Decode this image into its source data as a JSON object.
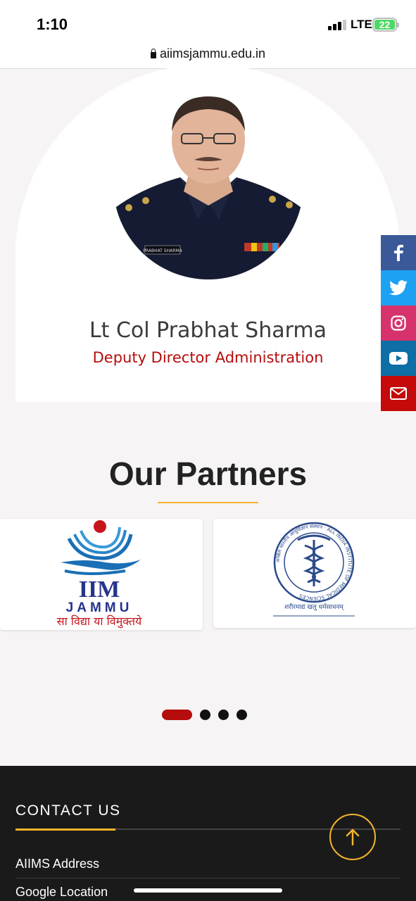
{
  "status_bar": {
    "time": "1:10",
    "network": "LTE",
    "battery": "22"
  },
  "browser": {
    "url": "aiimsjammu.edu.in"
  },
  "profile": {
    "name": "Lt Col Prabhat Sharma",
    "designation": "Deputy Director Administration",
    "badge_text": "PRABHAT SHARMA"
  },
  "social": [
    {
      "name": "facebook",
      "icon": "facebook-icon",
      "color": "#3b5998"
    },
    {
      "name": "twitter",
      "icon": "twitter-icon",
      "color": "#1da1f2"
    },
    {
      "name": "instagram",
      "icon": "instagram-icon",
      "color": "#d6336c"
    },
    {
      "name": "youtube",
      "icon": "youtube-icon",
      "color": "#0e6ea6"
    },
    {
      "name": "email",
      "icon": "mail-icon",
      "color": "#c40a0a"
    }
  ],
  "partners": {
    "title": "Our Partners",
    "logos": [
      {
        "name": "IIM Jammu",
        "line1": "IIM",
        "line2": "JAMMU",
        "motto": "सा विद्या या विमुक्तये"
      },
      {
        "name": "AIIMS",
        "ring_text": "अखिल भारतीय आयुर्विज्ञान संस्थान · ALL INDIA INSTITUTE OF MEDICAL SCIENCES",
        "motto": "शरीरमाद्यं खलु धर्मसाधनम्"
      }
    ],
    "carousel": {
      "pages": 4,
      "active": 0
    }
  },
  "footer": {
    "heading": "CONTACT US",
    "links": [
      "AIIMS Address",
      "Google Location"
    ]
  },
  "colors": {
    "accent": "#f2b52b",
    "brand_red": "#b50d0d",
    "footer_bg": "#1b1a1a"
  }
}
